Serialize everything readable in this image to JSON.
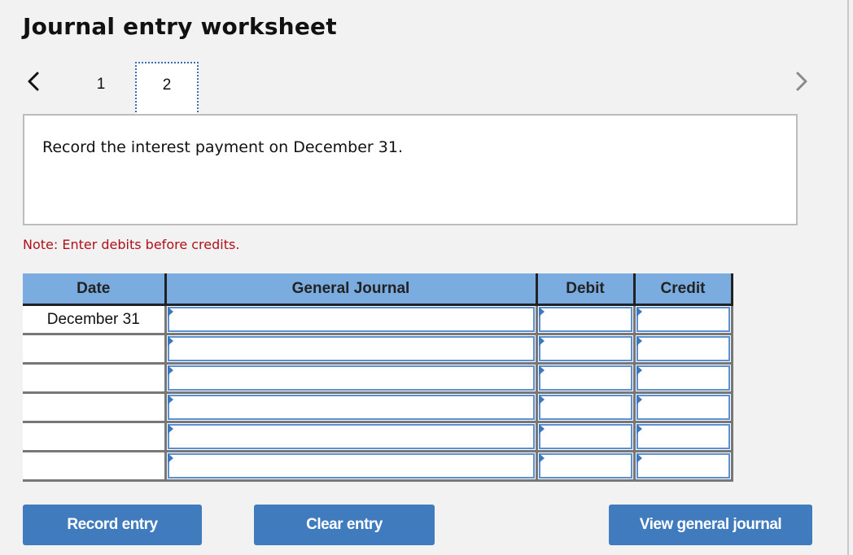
{
  "page": {
    "title": "Journal entry worksheet"
  },
  "pager": {
    "prev_icon": "chevron-left-icon",
    "next_icon": "chevron-right-icon",
    "tabs": [
      {
        "label": "1",
        "active": false
      },
      {
        "label": "2",
        "active": true
      }
    ]
  },
  "prompt": {
    "text": "Record the interest payment on December 31."
  },
  "note": "Note: Enter debits before credits.",
  "colors": {
    "header_bg": "#7aace0",
    "button_bg": "#3f7bbd",
    "note_text": "#b0101a"
  },
  "journal": {
    "columns": [
      "Date",
      "General Journal",
      "Debit",
      "Credit"
    ],
    "rows": [
      {
        "date": "December 31",
        "account": "",
        "debit": "",
        "credit": ""
      },
      {
        "date": "",
        "account": "",
        "debit": "",
        "credit": ""
      },
      {
        "date": "",
        "account": "",
        "debit": "",
        "credit": ""
      },
      {
        "date": "",
        "account": "",
        "debit": "",
        "credit": ""
      },
      {
        "date": "",
        "account": "",
        "debit": "",
        "credit": ""
      },
      {
        "date": "",
        "account": "",
        "debit": "",
        "credit": ""
      }
    ]
  },
  "buttons": {
    "record": "Record entry",
    "clear": "Clear entry",
    "view": "View general journal"
  }
}
